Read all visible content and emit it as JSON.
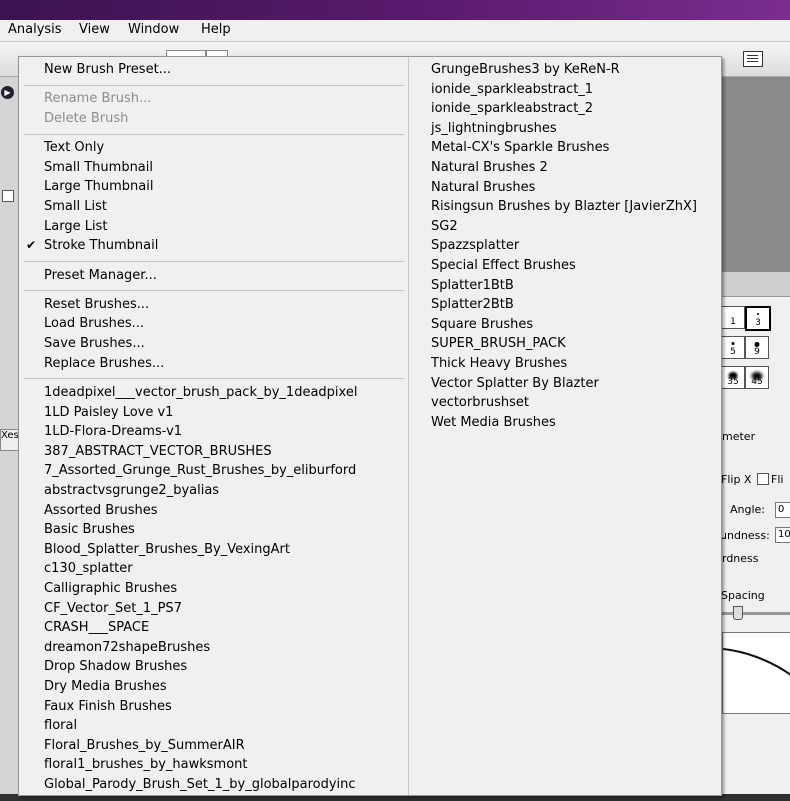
{
  "menubar": {
    "items": [
      "Analysis",
      "View",
      "Window",
      "Help"
    ]
  },
  "menu": {
    "col1": [
      {
        "label": "New Brush Preset...",
        "disabled": false
      },
      {
        "sep": true
      },
      {
        "label": "Rename Brush...",
        "disabled": true
      },
      {
        "label": "Delete Brush",
        "disabled": true
      },
      {
        "sep": true
      },
      {
        "label": "Text Only",
        "disabled": false
      },
      {
        "label": "Small Thumbnail",
        "disabled": false
      },
      {
        "label": "Large Thumbnail",
        "disabled": false
      },
      {
        "label": "Small List",
        "disabled": false
      },
      {
        "label": "Large List",
        "disabled": false
      },
      {
        "label": "Stroke Thumbnail",
        "disabled": false,
        "checked": true
      },
      {
        "sep": true
      },
      {
        "label": "Preset Manager...",
        "disabled": false
      },
      {
        "sep": true
      },
      {
        "label": "Reset Brushes...",
        "disabled": false
      },
      {
        "label": "Load Brushes...",
        "disabled": false
      },
      {
        "label": "Save Brushes...",
        "disabled": false
      },
      {
        "label": "Replace Brushes...",
        "disabled": false
      },
      {
        "sep": true
      },
      {
        "label": "1deadpixel___vector_brush_pack_by_1deadpixel"
      },
      {
        "label": "1LD Paisley Love v1"
      },
      {
        "label": "1LD-Flora-Dreams-v1"
      },
      {
        "label": "387_ABSTRACT_VECTOR_BRUSHES"
      },
      {
        "label": "7_Assorted_Grunge_Rust_Brushes_by_eliburford"
      },
      {
        "label": "abstractvsgrunge2_byalias"
      },
      {
        "label": "Assorted Brushes"
      },
      {
        "label": "Basic Brushes"
      },
      {
        "label": "Blood_Splatter_Brushes_By_VexingArt"
      },
      {
        "label": "c130_splatter"
      },
      {
        "label": "Calligraphic Brushes"
      },
      {
        "label": "CF_Vector_Set_1_PS7"
      },
      {
        "label": "CRASH___SPACE"
      },
      {
        "label": "dreamon72shapeBrushes"
      },
      {
        "label": "Drop Shadow Brushes"
      },
      {
        "label": "Dry Media Brushes"
      },
      {
        "label": "Faux Finish Brushes"
      },
      {
        "label": "floral"
      },
      {
        "label": "Floral_Brushes_by_SummerAIR"
      },
      {
        "label": "floral1_brushes_by_hawksmont"
      },
      {
        "label": "Global_Parody_Brush_Set_1_by_globalparodyinc"
      }
    ],
    "col2": [
      "GrungeBrushes3 by KeReN-R",
      "ionide_sparkleabstract_1",
      "ionide_sparkleabstract_2",
      "js_lightningbrushes",
      "Metal-CX's Sparkle Brushes",
      "Natural Brushes 2",
      "Natural Brushes",
      "Risingsun  Brushes by Blazter [JavierZhX]",
      "SG2",
      "Spazzsplatter",
      "Special Effect Brushes",
      "Splatter1BtB",
      "Splatter2BtB",
      "Square Brushes",
      "SUPER_BRUSH_PACK",
      "Thick Heavy Brushes",
      "Vector Splatter By Blazter",
      "vectorbrushset",
      "Wet Media Brushes"
    ]
  },
  "brush_panel": {
    "tips": [
      "1",
      "3",
      "5",
      "9",
      "35",
      "45"
    ],
    "diameter_label": "meter",
    "flip_x_label": "Flip X",
    "flip_y_label": "Fli",
    "angle_label": "Angle:",
    "angle_value": "0",
    "roundness_label": "undness:",
    "roundness_value": "10",
    "hardness_label": "rdness",
    "spacing_label": "Spacing",
    "spacing_checked": true
  },
  "left_tab_text": "Xes",
  "check_glyph": "✔"
}
